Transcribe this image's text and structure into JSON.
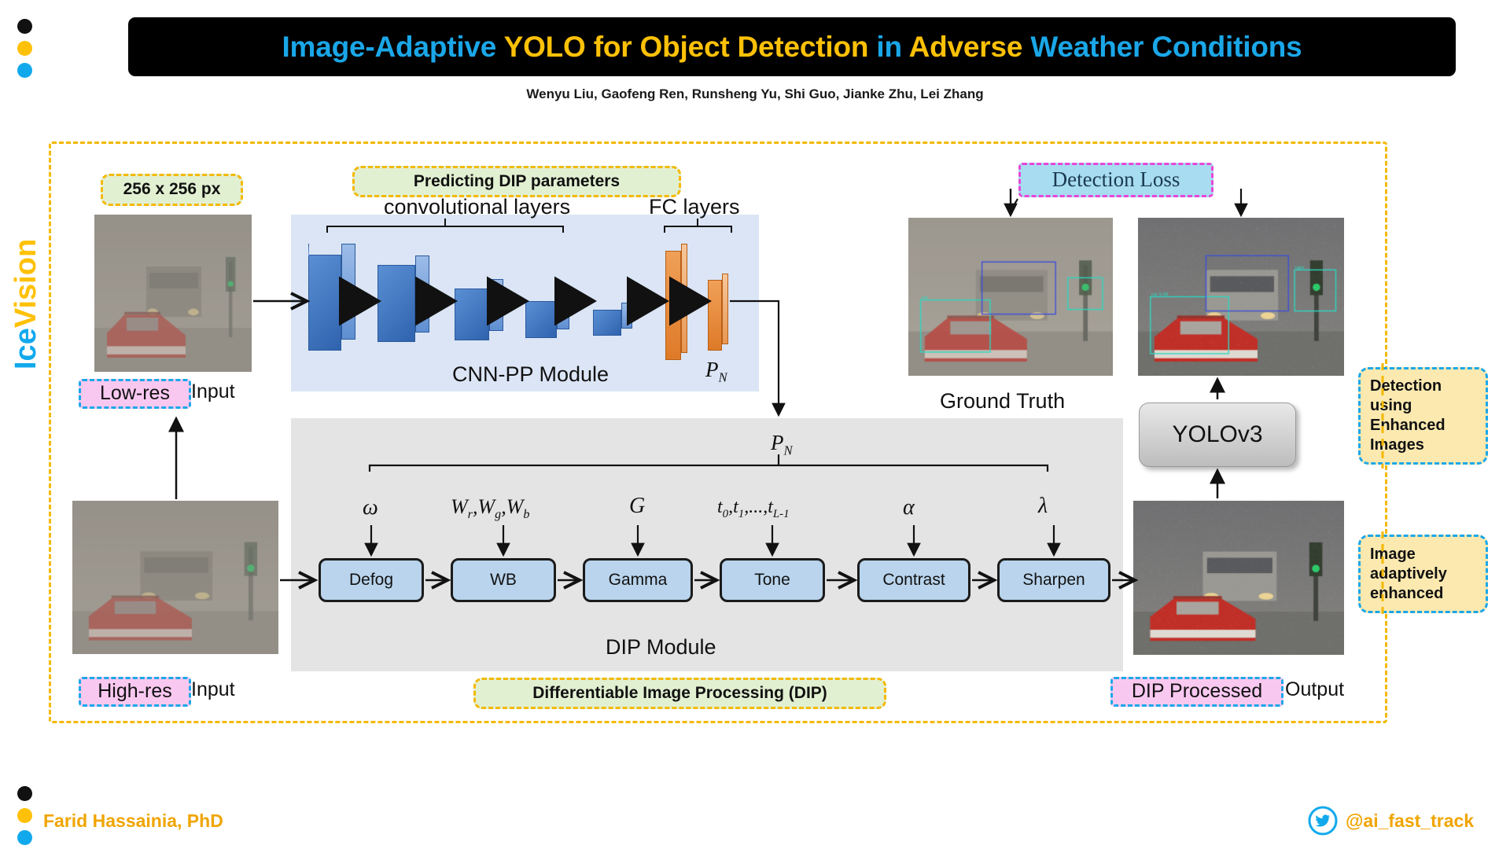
{
  "title": {
    "parts": [
      {
        "text": "Image-Adaptive ",
        "color": "blue"
      },
      {
        "text": "YOLO ",
        "color": "yellow"
      },
      {
        "text": "for Object Detection ",
        "color": "yellow"
      },
      {
        "text": "in ",
        "color": "blue"
      },
      {
        "text": "Adverse ",
        "color": "yellow"
      },
      {
        "text": "Weather Conditions",
        "color": "blue"
      }
    ],
    "full": "Image-Adaptive YOLO for Object Detection in Adverse Weather Conditions",
    "blue": "#1aa7e8",
    "yellow": "#ffc107",
    "background": "#000000"
  },
  "authors": "Wenyu Liu, Gaofeng Ren, Runsheng Yu, Shi Guo, Jianke Zhu, Lei Zhang",
  "brand": {
    "sidebar_ice": "Ice",
    "sidebar_vision": "Vision",
    "dot_colors": [
      "#111111",
      "#ffc107",
      "#11a9ec"
    ]
  },
  "annotations": {
    "resolution_badge": "256 x 256 px",
    "predicting_dip": "Predicting DIP parameters",
    "detection_loss": "Detection Loss",
    "differentiable_dip": "Differentiable Image Processing (DIP)",
    "detection_using_enhanced": "Detection using Enhanced Images",
    "image_adaptively_enhanced": "Image adaptively enhanced"
  },
  "labels": {
    "low_res_tag": "Low-res",
    "low_res_rest": "Input",
    "high_res_tag": "High-res",
    "high_res_rest": "Input",
    "dip_processed_tag": "DIP Processed",
    "dip_processed_rest": "Output",
    "ground_truth": "Ground Truth",
    "conv_layers": "convolutional layers",
    "fc_layers": "FC layers",
    "cnn_pp_module": "CNN-PP Module",
    "dip_module": "DIP Module",
    "yolo_box": "YOLOv3",
    "p_n": "P",
    "p_n_sub": "N"
  },
  "dip_pipeline": {
    "ops": [
      "Defog",
      "WB",
      "Gamma",
      "Tone",
      "Contrast",
      "Sharpen"
    ],
    "params": [
      {
        "main": "ω",
        "sub": ""
      },
      {
        "main": "W",
        "sub": "r",
        "extra": ",W_g,W_b"
      },
      {
        "main": "G",
        "sub": ""
      },
      {
        "main": "t",
        "sub": "0",
        "extra": ",t_1,...,t_L-1"
      },
      {
        "main": "α",
        "sub": ""
      },
      {
        "main": "λ",
        "sub": ""
      }
    ],
    "param_text": [
      "ω",
      "Wr,Wg,Wb",
      "G",
      "t0,t1,...,tL-1",
      "α",
      "λ"
    ]
  },
  "footer": {
    "author": "Farid Hassainia, PhD",
    "twitter_handle": "@ai_fast_track",
    "twitter_color": "#11a9ec"
  },
  "colors": {
    "frame_dashed": "#f5b800",
    "badge_green_bg": "#e2f0d2",
    "badge_pink_bg": "#f9c8f0",
    "badge_blue_bg": "#a8dcf0",
    "badge_yellow_bg": "#fce9b0",
    "cnn_panel_bg": "#dbe5f5",
    "dip_panel_bg": "#e4e4e4",
    "op_box_bg": "#b9d4ec"
  }
}
